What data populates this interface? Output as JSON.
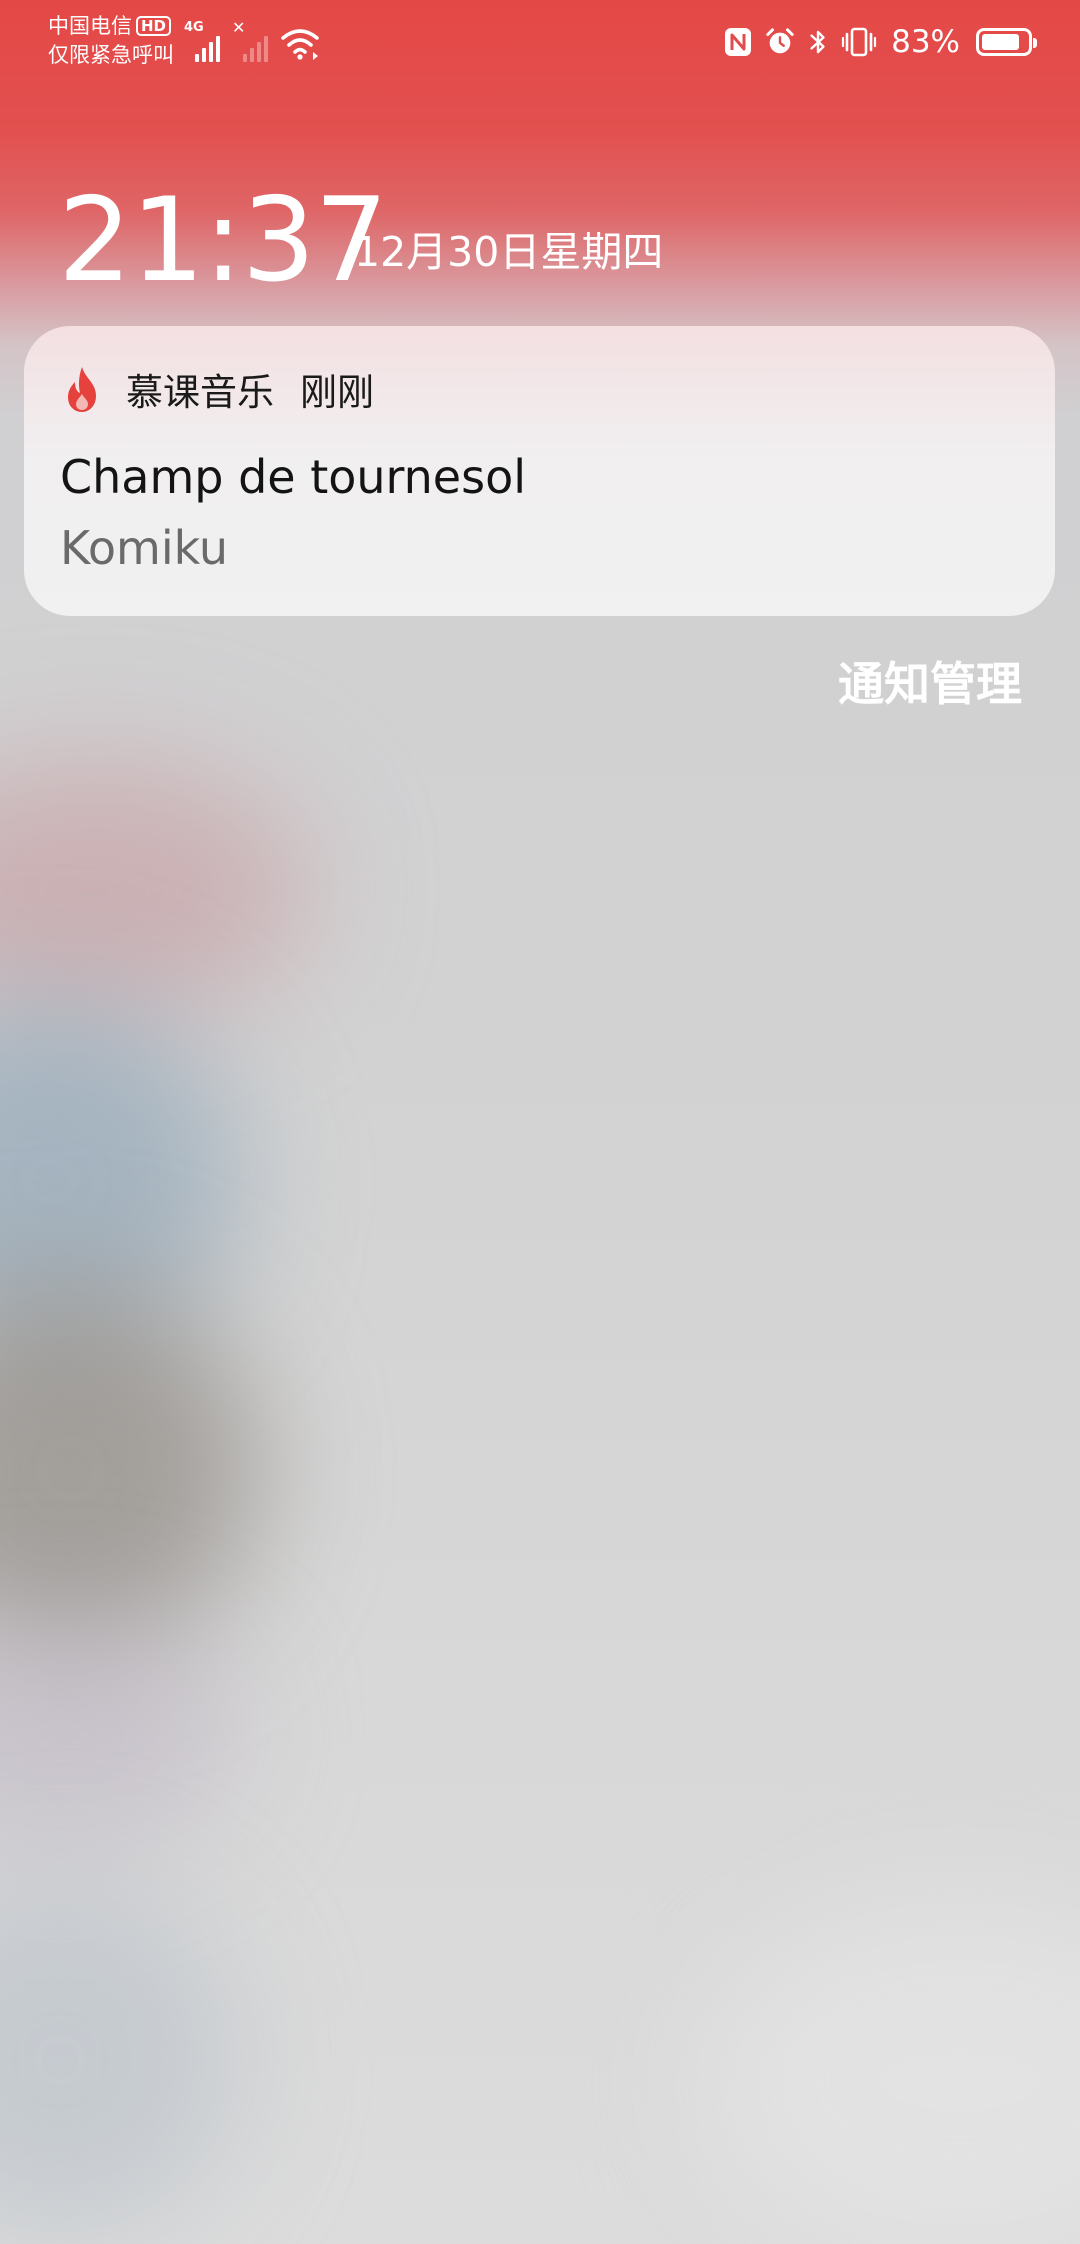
{
  "status_bar": {
    "carrier": "中国电信",
    "hd_badge": "HD",
    "emergency_text": "仅限紧急呼叫",
    "network_type": "4G",
    "battery_percent": "83%",
    "battery_level": 0.83,
    "icons": [
      "signal-icon",
      "no-signal-icon",
      "wifi-icon",
      "nfc-icon",
      "alarm-icon",
      "bluetooth-icon",
      "vibrate-icon",
      "battery-icon"
    ]
  },
  "lock_screen": {
    "time": "21:37",
    "date": "12月30日星期四"
  },
  "notification": {
    "app_name": "慕课音乐",
    "time": "刚刚",
    "title": "Champ de tournesol",
    "subtitle": "Komiku",
    "app_icon": "flame-icon",
    "accent_color": "#e5423d"
  },
  "notification_manage": {
    "label": "通知管理"
  }
}
